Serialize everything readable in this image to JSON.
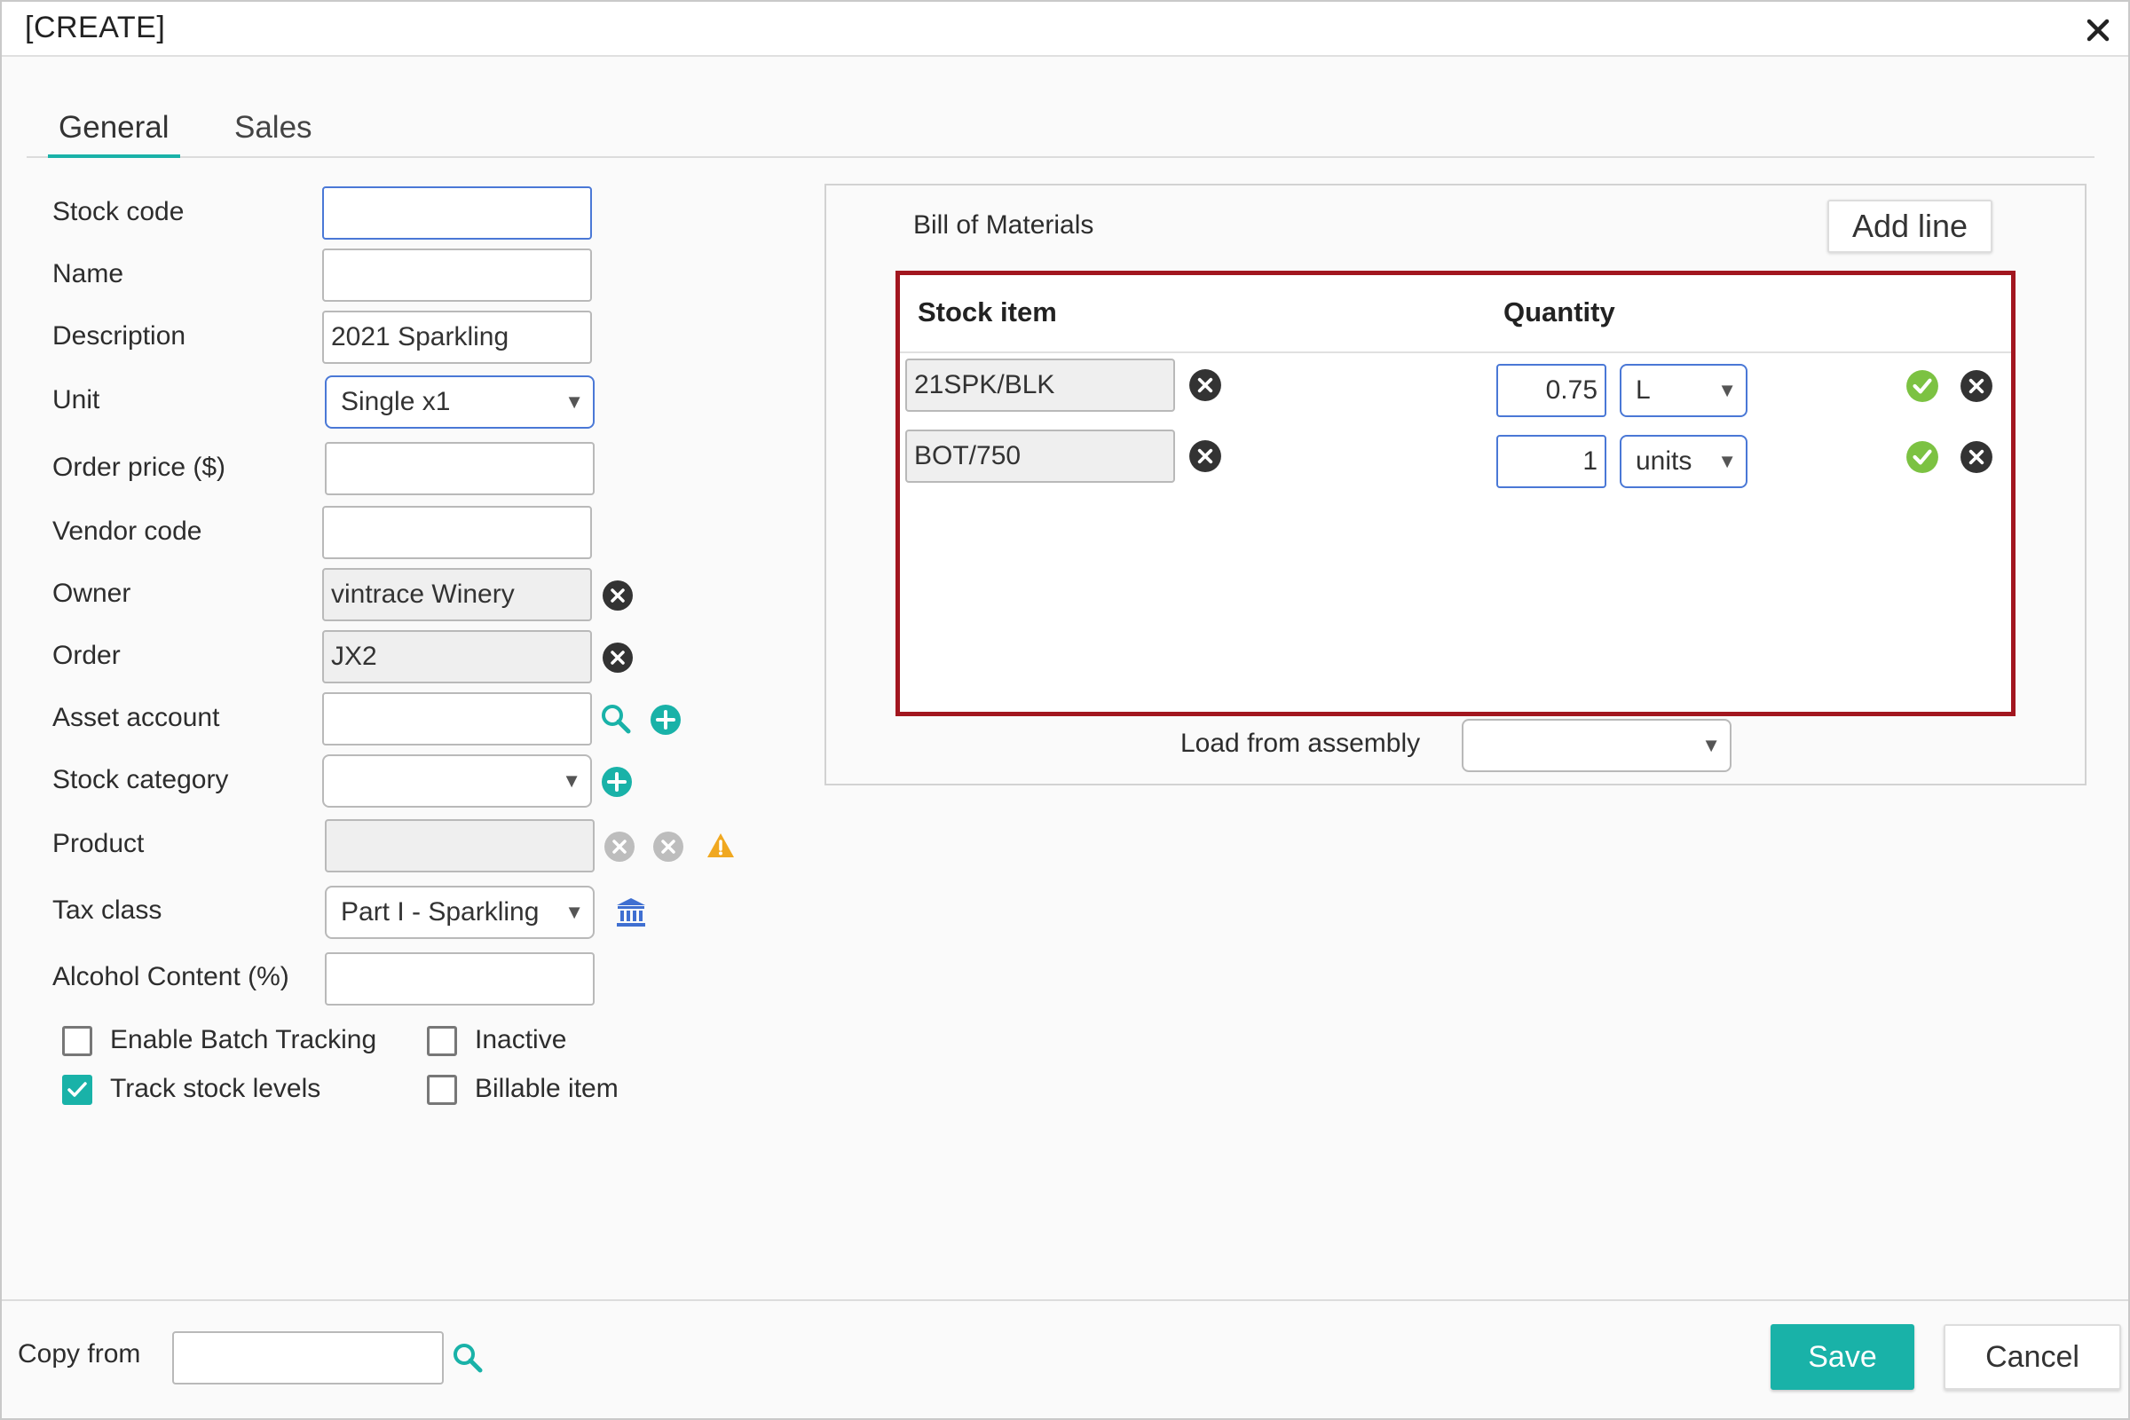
{
  "window": {
    "title": "[CREATE]"
  },
  "tabs": [
    {
      "label": "General",
      "active": true
    },
    {
      "label": "Sales",
      "active": false
    }
  ],
  "form": {
    "stock_code": {
      "label": "Stock code",
      "value": ""
    },
    "name": {
      "label": "Name",
      "value": ""
    },
    "description": {
      "label": "Description",
      "value": "2021 Sparkling"
    },
    "unit": {
      "label": "Unit",
      "value": "Single x1"
    },
    "order_price": {
      "label": "Order price ($)",
      "value": ""
    },
    "vendor_code": {
      "label": "Vendor code",
      "value": ""
    },
    "owner": {
      "label": "Owner",
      "value": "vintrace Winery"
    },
    "order": {
      "label": "Order",
      "value": "JX2"
    },
    "asset_account": {
      "label": "Asset account",
      "value": ""
    },
    "stock_category": {
      "label": "Stock category",
      "value": ""
    },
    "product": {
      "label": "Product",
      "value": ""
    },
    "tax_class": {
      "label": "Tax class",
      "value": "Part I - Sparkling"
    },
    "alcohol_content": {
      "label": "Alcohol Content (%)",
      "value": ""
    }
  },
  "checkboxes": {
    "enable_batch_tracking": {
      "label": "Enable Batch Tracking",
      "checked": false
    },
    "inactive": {
      "label": "Inactive",
      "checked": false
    },
    "track_stock_levels": {
      "label": "Track stock levels",
      "checked": true
    },
    "billable_item": {
      "label": "Billable item",
      "checked": false
    }
  },
  "bom": {
    "title": "Bill of Materials",
    "add_line_label": "Add line",
    "columns": {
      "stock_item": "Stock item",
      "quantity": "Quantity"
    },
    "rows": [
      {
        "stock_item": "21SPK/BLK",
        "quantity": "0.75",
        "unit": "L"
      },
      {
        "stock_item": "BOT/750",
        "quantity": "1",
        "unit": "units"
      }
    ],
    "load_from_assembly_label": "Load from assembly",
    "load_from_assembly_value": ""
  },
  "footer": {
    "copy_from_label": "Copy from",
    "copy_from_value": "",
    "save_label": "Save",
    "cancel_label": "Cancel"
  },
  "colors": {
    "accent": "#19b2a8",
    "highlight_border": "#a2161f",
    "focus_border": "#4a78d6",
    "confirm_green": "#7cc242",
    "warning": "#f0a820",
    "icon_blue": "#3f6fd1"
  },
  "icons": {
    "close": "close-icon",
    "clear": "clear-circle-icon",
    "search": "search-icon",
    "add": "add-circle-icon",
    "confirm": "check-circle-icon",
    "warning": "warning-icon",
    "tax": "bank-icon"
  }
}
